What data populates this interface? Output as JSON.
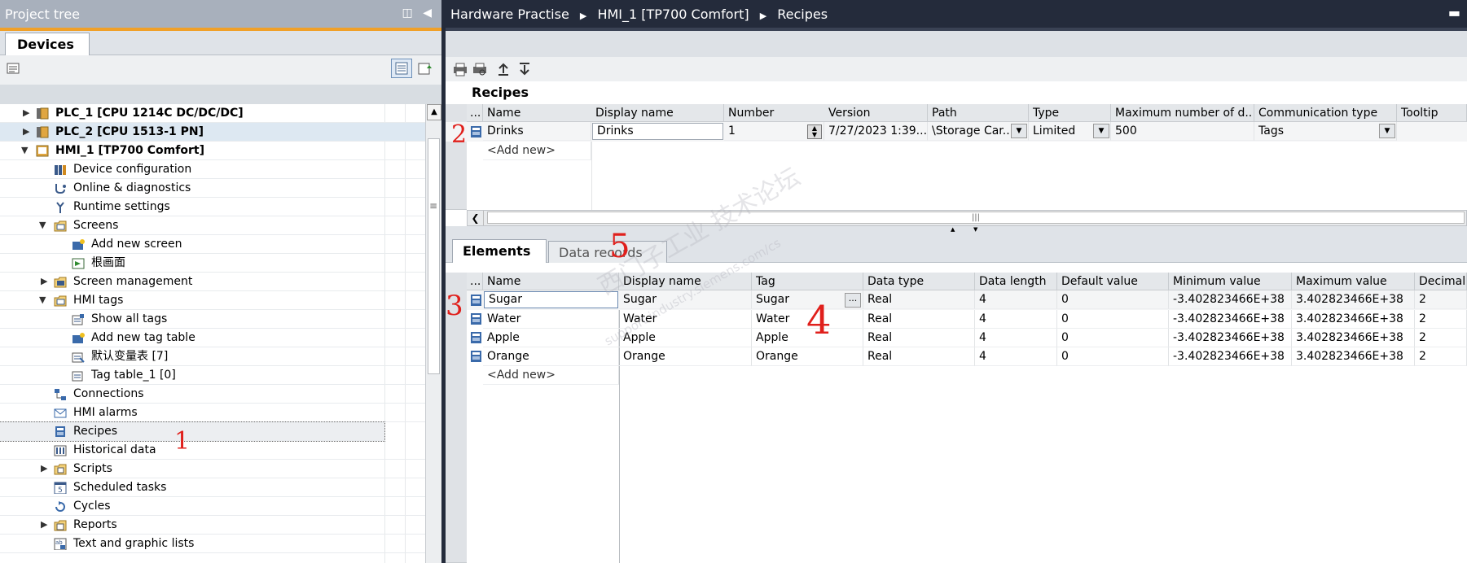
{
  "project_tree": {
    "title": "Project tree",
    "tab": "Devices",
    "items": [
      {
        "label": "PLC_1 [CPU 1214C DC/DC/DC]",
        "level": 0,
        "expander": "collapsed",
        "bold": true
      },
      {
        "label": "PLC_2 [CPU 1513-1 PN]",
        "level": 0,
        "expander": "collapsed",
        "bold": true
      },
      {
        "label": "HMI_1 [TP700 Comfort]",
        "level": 0,
        "expander": "expanded",
        "bold": true
      },
      {
        "label": "Device configuration",
        "level": 1,
        "expander": "none"
      },
      {
        "label": "Online & diagnostics",
        "level": 1,
        "expander": "none"
      },
      {
        "label": "Runtime settings",
        "level": 1,
        "expander": "none"
      },
      {
        "label": "Screens",
        "level": 1,
        "expander": "expanded"
      },
      {
        "label": "Add new screen",
        "level": 2,
        "expander": "none"
      },
      {
        "label": "根画面",
        "level": 2,
        "expander": "none"
      },
      {
        "label": "Screen management",
        "level": 1,
        "expander": "collapsed"
      },
      {
        "label": "HMI tags",
        "level": 1,
        "expander": "expanded"
      },
      {
        "label": "Show all tags",
        "level": 2,
        "expander": "none"
      },
      {
        "label": "Add new tag table",
        "level": 2,
        "expander": "none"
      },
      {
        "label": "默认变量表 [7]",
        "level": 2,
        "expander": "none"
      },
      {
        "label": "Tag table_1 [0]",
        "level": 2,
        "expander": "none"
      },
      {
        "label": "Connections",
        "level": 1,
        "expander": "none"
      },
      {
        "label": "HMI alarms",
        "level": 1,
        "expander": "none"
      },
      {
        "label": "Recipes",
        "level": 1,
        "expander": "none"
      },
      {
        "label": "Historical data",
        "level": 1,
        "expander": "none"
      },
      {
        "label": "Scripts",
        "level": 1,
        "expander": "collapsed"
      },
      {
        "label": "Scheduled tasks",
        "level": 1,
        "expander": "none"
      },
      {
        "label": "Cycles",
        "level": 1,
        "expander": "none"
      },
      {
        "label": "Reports",
        "level": 1,
        "expander": "collapsed"
      },
      {
        "label": "Text and graphic lists",
        "level": 1,
        "expander": "none"
      }
    ]
  },
  "breadcrumb": [
    "Hardware Practise",
    "HMI_1 [TP700 Comfort]",
    "Recipes"
  ],
  "recipes": {
    "section_label": "Recipes",
    "columns": [
      "...",
      "Name",
      "Display name",
      "Number",
      "Version",
      "Path",
      "Type",
      "Maximum number of d..",
      "Communication type",
      "Tooltip"
    ],
    "rows": [
      {
        "name": "Drinks",
        "display_name": "Drinks",
        "number": "1",
        "version": "7/27/2023 1:39...",
        "path": "\\Storage Car...",
        "type": "Limited",
        "max": "500",
        "comm": "Tags"
      }
    ],
    "add_new": "<Add new>"
  },
  "tabs": {
    "elements": "Elements",
    "data_records": "Data records"
  },
  "elements": {
    "columns": [
      "...",
      "Name",
      "Display name",
      "Tag",
      "Data type",
      "Data length",
      "Default value",
      "Minimum value",
      "Maximum value",
      "Decimal"
    ],
    "rows": [
      {
        "name": "Sugar",
        "display_name": "Sugar",
        "tag": "Sugar",
        "data_type": "Real",
        "length": "4",
        "default": "0",
        "min": "-3.402823466E+38",
        "max": "3.402823466E+38",
        "decimal": "2"
      },
      {
        "name": "Water",
        "display_name": "Water",
        "tag": "Water",
        "data_type": "Real",
        "length": "4",
        "default": "0",
        "min": "-3.402823466E+38",
        "max": "3.402823466E+38",
        "decimal": "2"
      },
      {
        "name": "Apple",
        "display_name": "Apple",
        "tag": "Apple",
        "data_type": "Real",
        "length": "4",
        "default": "0",
        "min": "-3.402823466E+38",
        "max": "3.402823466E+38",
        "decimal": "2"
      },
      {
        "name": "Orange",
        "display_name": "Orange",
        "tag": "Orange",
        "data_type": "Real",
        "length": "4",
        "default": "0",
        "min": "-3.402823466E+38",
        "max": "3.402823466E+38",
        "decimal": "2"
      }
    ],
    "add_new": "<Add new>"
  },
  "annotations": [
    "1",
    "2",
    "3",
    "4",
    "5"
  ],
  "watermark": {
    "line1": "西门子工业 技术论坛",
    "line2": "support.industry.siemens.com/cs"
  },
  "colors": {
    "title_dark": "#242b3b",
    "accent_orange": "#f0a028",
    "annotation_red": "#e0201c"
  }
}
